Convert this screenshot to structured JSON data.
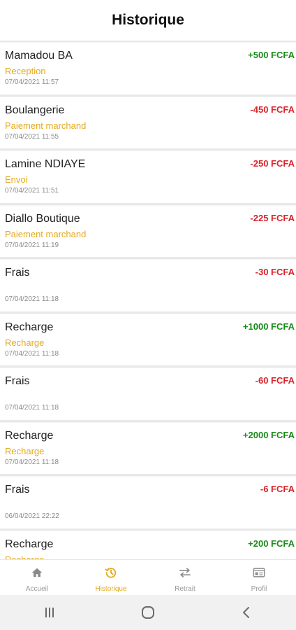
{
  "header": {
    "title": "Historique"
  },
  "transactions": [
    {
      "name": "Mamadou BA",
      "type": "Reception",
      "date": "07/04/2021 11:57",
      "amount": "+500 FCFA",
      "sign": "pos"
    },
    {
      "name": "Boulangerie",
      "type": "Paiement marchand",
      "date": "07/04/2021 11:55",
      "amount": "-450 FCFA",
      "sign": "neg"
    },
    {
      "name": "Lamine NDIAYE",
      "type": "Envoi",
      "date": "07/04/2021 11:51",
      "amount": "-250 FCFA",
      "sign": "neg"
    },
    {
      "name": "Diallo Boutique",
      "type": "Paiement marchand",
      "date": "07/04/2021 11:19",
      "amount": "-225 FCFA",
      "sign": "neg"
    },
    {
      "name": "Frais",
      "type": "",
      "date": "07/04/2021 11:18",
      "amount": "-30 FCFA",
      "sign": "neg"
    },
    {
      "name": "Recharge",
      "type": "Recharge",
      "date": "07/04/2021 11:18",
      "amount": "+1000 FCFA",
      "sign": "pos"
    },
    {
      "name": "Frais",
      "type": "",
      "date": "07/04/2021 11:18",
      "amount": "-60 FCFA",
      "sign": "neg"
    },
    {
      "name": "Recharge",
      "type": "Recharge",
      "date": "07/04/2021 11:18",
      "amount": "+2000 FCFA",
      "sign": "pos"
    },
    {
      "name": "Frais",
      "type": "",
      "date": "06/04/2021 22:22",
      "amount": "-6 FCFA",
      "sign": "neg"
    },
    {
      "name": "Recharge",
      "type": "Recharge",
      "date": "",
      "amount": "+200 FCFA",
      "sign": "pos"
    }
  ],
  "tabbar": {
    "tabs": [
      {
        "label": "Accueil",
        "icon": "home-icon",
        "active": false
      },
      {
        "label": "Historique",
        "icon": "history-icon",
        "active": true
      },
      {
        "label": "Retrait",
        "icon": "transfer-arrows-icon",
        "active": false
      },
      {
        "label": "Profil",
        "icon": "id-card-icon",
        "active": false
      }
    ]
  },
  "colors": {
    "accent": "#e3a91f",
    "positive": "#1a8a1a",
    "negative": "#d9232a",
    "inactive": "#9a9a9a"
  },
  "system_nav": {
    "icons": [
      "recent-apps-icon",
      "home-circle-icon",
      "back-chevron-icon"
    ]
  }
}
